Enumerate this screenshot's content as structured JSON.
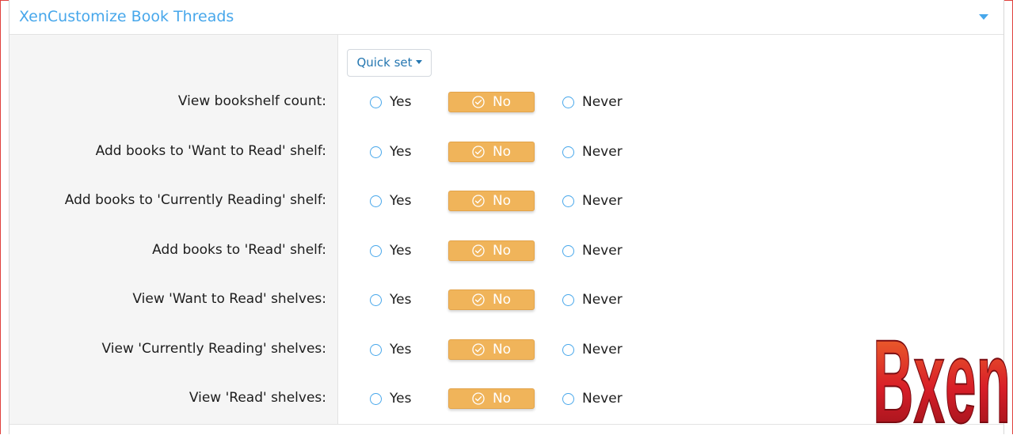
{
  "block": {
    "title": "XenCustomize Book Threads"
  },
  "quick_set": {
    "label": "Quick set"
  },
  "options": {
    "yes": "Yes",
    "no": "No",
    "never": "Never"
  },
  "permissions": [
    {
      "label": "View bookshelf count:",
      "selected": "No"
    },
    {
      "label": "Add books to 'Want to Read' shelf:",
      "selected": "No"
    },
    {
      "label": "Add books to 'Currently Reading' shelf:",
      "selected": "No"
    },
    {
      "label": "Add books to 'Read' shelf:",
      "selected": "No"
    },
    {
      "label": "View 'Want to Read' shelves:",
      "selected": "No"
    },
    {
      "label": "View 'Currently Reading' shelves:",
      "selected": "No"
    },
    {
      "label": "View 'Read' shelves:",
      "selected": "No"
    }
  ],
  "watermark": {
    "text": "Bxen",
    "colors": [
      "#f2772c",
      "#d81e28",
      "#8e1018"
    ]
  },
  "colors": {
    "accent": "#47a7eb",
    "selected": "#f0b45a",
    "frame": "#e0403c"
  }
}
